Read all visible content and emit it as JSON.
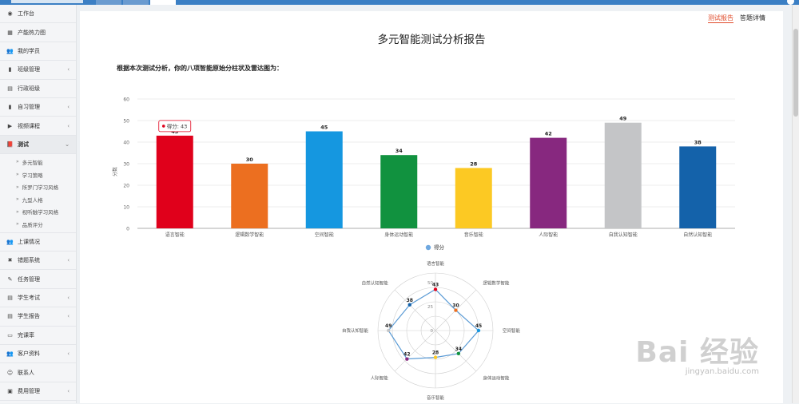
{
  "sidebar": {
    "items": [
      {
        "label": "工作台",
        "icon": "dashboard-icon",
        "glyph": "◉",
        "chevron": false
      },
      {
        "label": "产能热力图",
        "icon": "grid-icon",
        "glyph": "▦",
        "chevron": false
      },
      {
        "label": "我的学员",
        "icon": "users-icon",
        "glyph": "👥",
        "chevron": false
      },
      {
        "label": "班级管理",
        "icon": "chart-icon",
        "glyph": "▮",
        "chevron": true
      },
      {
        "label": "行政班级",
        "icon": "table-icon",
        "glyph": "▤",
        "chevron": false
      },
      {
        "label": "自习管理",
        "icon": "chart-icon",
        "glyph": "▮",
        "chevron": true
      },
      {
        "label": "视频课程",
        "icon": "video-icon",
        "glyph": "▶",
        "chevron": true
      },
      {
        "label": "测试",
        "icon": "book-icon",
        "glyph": "📕",
        "chevron": true,
        "open": true
      },
      {
        "label": "上课情况",
        "icon": "users-icon",
        "glyph": "👥",
        "chevron": false
      },
      {
        "label": "错题系统",
        "icon": "close-icon",
        "glyph": "✖",
        "chevron": true
      },
      {
        "label": "任务管理",
        "icon": "edit-icon",
        "glyph": "✎",
        "chevron": false
      },
      {
        "label": "学生考试",
        "icon": "file-icon",
        "glyph": "▤",
        "chevron": true
      },
      {
        "label": "学生报告",
        "icon": "file-icon",
        "glyph": "▤",
        "chevron": true
      },
      {
        "label": "完课率",
        "icon": "card-icon",
        "glyph": "▭",
        "chevron": false
      },
      {
        "label": "客户资料",
        "icon": "users-icon",
        "glyph": "👥",
        "chevron": true
      },
      {
        "label": "联系人",
        "icon": "contact-icon",
        "glyph": "☺",
        "chevron": false
      },
      {
        "label": "费用管理",
        "icon": "money-icon",
        "glyph": "▣",
        "chevron": true
      }
    ],
    "sub_items": [
      "多元智能",
      "学习策略",
      "所罗门学习风格",
      "九型人格",
      "视听触学习风格",
      "品质评分"
    ],
    "sub_bullet": "»",
    "chevron_closed": "‹",
    "chevron_open": "⌄"
  },
  "header": {
    "tabs": [
      "测试报告",
      "答题详情"
    ],
    "title": "多元智能测试分析报告",
    "subtitle": "根据本次测试分析，你的八项智能原始分柱状及雷达图为："
  },
  "watermark": {
    "brand": "Bai 经验",
    "url": "jingyan.baidu.com"
  },
  "chart_data": [
    {
      "type": "bar",
      "categories": [
        "语言智能",
        "逻辑数学智能",
        "空间智能",
        "身体运动智能",
        "音乐智能",
        "人际智能",
        "自我认知智能",
        "自然认知智能"
      ],
      "values": [
        43,
        30,
        45,
        34,
        28,
        42,
        49,
        38
      ],
      "colors": [
        "#e0001b",
        "#ec6f20",
        "#1597e0",
        "#11923f",
        "#fcc923",
        "#87287f",
        "#c4c5c7",
        "#1462aa"
      ],
      "ylabel": "分数",
      "ylim": [
        0,
        60
      ],
      "yticks": [
        0,
        10,
        20,
        30,
        40,
        50,
        60
      ],
      "legend": {
        "label": "得分",
        "position": "bottom",
        "color": "#6fa8e0"
      },
      "tooltip": {
        "label": "得分",
        "value": 43,
        "category": "语言智能"
      },
      "grid": true
    },
    {
      "type": "radar",
      "indicators": [
        "语言智能",
        "逻辑数学智能",
        "空间智能",
        "身体运动智能",
        "音乐智能",
        "人际智能",
        "自我认知智能",
        "自然认知智能"
      ],
      "values": [
        43,
        30,
        45,
        34,
        28,
        42,
        49,
        38
      ],
      "max": 60,
      "rings": [
        0,
        25,
        50
      ],
      "line_color": "#5b9bd5"
    }
  ]
}
